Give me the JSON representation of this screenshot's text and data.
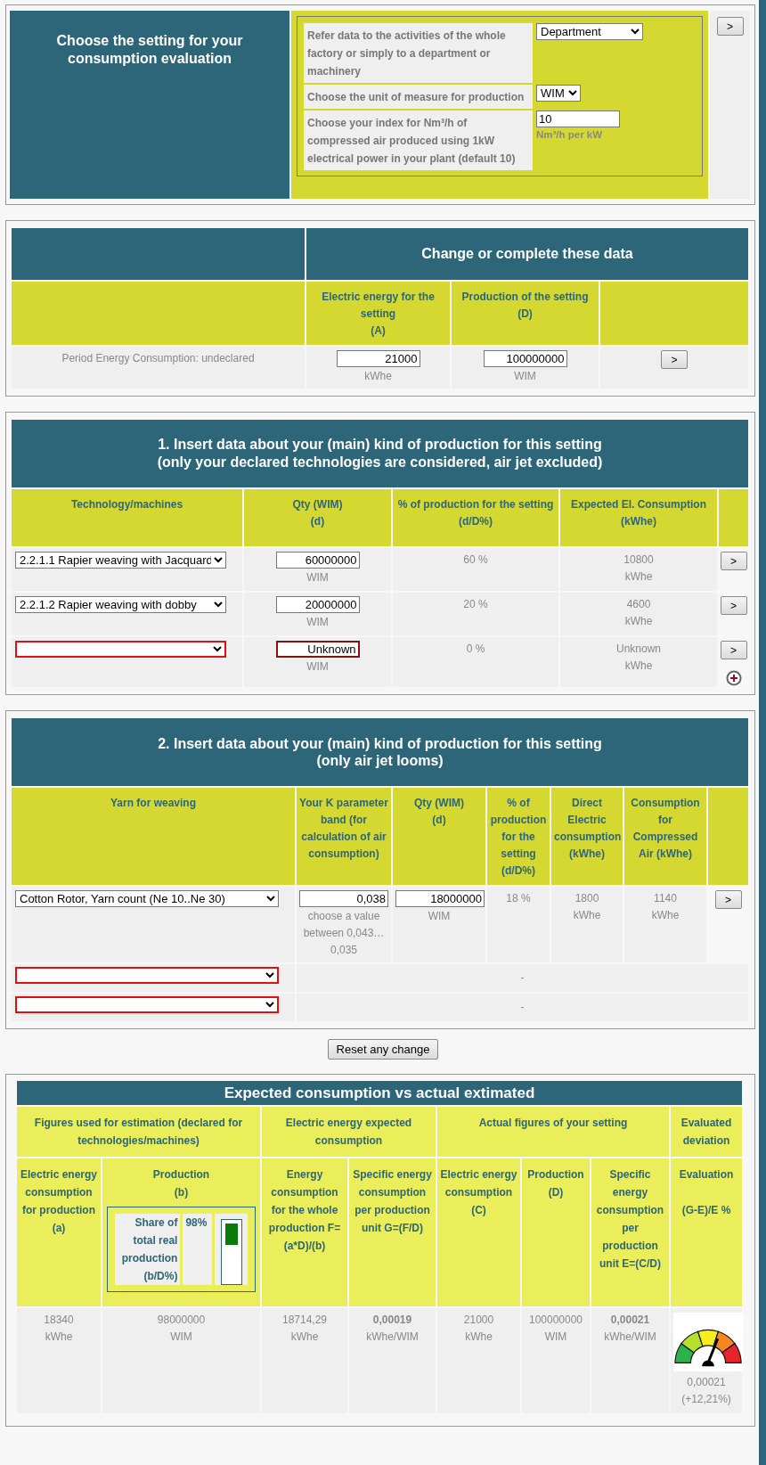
{
  "setting": {
    "title": "Choose the setting for your consumption evaluation",
    "button": ">",
    "rows": [
      {
        "label": "Refer data to the activities of the whole factory or simply to a department or machinery",
        "kind": "select",
        "value": "Department"
      },
      {
        "label": "Choose the unit of measure for production",
        "kind": "select",
        "value": "WIM"
      },
      {
        "label": "Choose your index for Nm³/h of compressed air produced using 1kW electrical power in your plant (default 10)",
        "kind": "input",
        "value": "10",
        "unit": "Nm³/h per kW"
      }
    ]
  },
  "data": {
    "title": "Change or complete these data",
    "columns": [
      "Electric energy for the setting\n(A)",
      "Production of the setting\n(D)"
    ],
    "row": {
      "label": "Period Energy Consumption: undeclared",
      "energy": "21000",
      "energy_unit": "kWhe",
      "production": "100000000",
      "production_unit": "WIM",
      "button": ">"
    }
  },
  "section1": {
    "title": "1. Insert data about your (main) kind of production for this setting\n(only your declared technologies are considered, air jet excluded)",
    "columns": [
      "Technology/machines",
      "Qty (WIM)\n(d)",
      "% of production for the setting\n(d/D%)",
      "Expected El. Consumption\n(kWhe)"
    ],
    "rows": [
      {
        "technology": "2.2.1.1 Rapier weaving with Jacquard",
        "invalid": false,
        "qty": "60000000",
        "qty_unit": "WIM",
        "share": "60 %",
        "consumption": "10800",
        "consumption_unit": "kWhe",
        "button": ">"
      },
      {
        "technology": "2.2.1.2 Rapier weaving with dobby",
        "invalid": false,
        "qty": "20000000",
        "qty_unit": "WIM",
        "share": "20 %",
        "consumption": "4600",
        "consumption_unit": "kWhe",
        "button": ">"
      },
      {
        "invalid": true,
        "qty": "Unknown",
        "qty_unit": "WIM",
        "share": "0 %",
        "consumption": "Unknown",
        "consumption_unit": "kWhe",
        "button": ">"
      }
    ]
  },
  "section2": {
    "title": "2. Insert data about your (main) kind of production for this setting\n(only air jet looms)",
    "columns": [
      "Yarn for weaving",
      "Your K parameter band (for calculation of air consumption)",
      "Qty (WIM)\n(d)",
      "% of production for the setting (d/D%)",
      "Direct Electric consumption (kWhe)",
      "Consumption for Compressed Air (kWhe)"
    ],
    "rows": [
      {
        "kind": "filled",
        "yarn": "Cotton Rotor, Yarn count (Ne 10..Ne 30)",
        "invalid": false,
        "k": "0,038",
        "k_hint": "choose a value between 0,043…0,035",
        "qty": "18000000",
        "qty_unit": "WIM",
        "share": "18 %",
        "direct": "1800",
        "direct_unit": "kWhe",
        "air": "1140",
        "air_unit": "kWhe",
        "button": ">"
      },
      {
        "kind": "empty",
        "invalid": true,
        "dash": "-"
      },
      {
        "kind": "empty",
        "invalid": true,
        "dash": "-"
      }
    ]
  },
  "reset_button": "Reset any change",
  "summary": {
    "title": "Expected consumption vs actual extimated",
    "groups": [
      "Figures used for estimation (declared for technologies/machines)",
      "Electric energy expected consumption",
      "Actual figures of your setting",
      "Evaluated deviation"
    ],
    "columns": [
      "Electric energy consumption for production\n(a)",
      "Production\n(b)",
      "Energy consumption for the whole production F=(a*D)/(b)",
      "Specific energy consumption per production unit G=(F/D)",
      "Electric energy consumption\n(C)",
      "Production\n(D)",
      "Specific energy consumption per production unit E=(C/D)",
      "Evaluation\n\n(G-E)/E %"
    ],
    "share": {
      "label": "Share of total real production (b/D%)",
      "value": "98%",
      "level": 0.98
    },
    "cells": [
      {
        "value": "18340",
        "unit": "kWhe",
        "emphasis": false
      },
      {
        "value": "98000000",
        "unit": "WIM",
        "emphasis": false
      },
      {
        "value": "18714,29",
        "unit": "kWhe",
        "emphasis": false
      },
      {
        "value": "0,00019",
        "unit": "kWhe/WIM",
        "emphasis": true
      },
      {
        "value": "21000",
        "unit": "kWhe",
        "emphasis": false
      },
      {
        "value": "100000000",
        "unit": "WIM",
        "emphasis": false
      },
      {
        "value": "0,00021",
        "unit": "kWhe/WIM",
        "emphasis": true
      }
    ],
    "evaluation": {
      "level": 0.62,
      "value": "0,00021",
      "deviation": "(+12,21%)"
    }
  }
}
